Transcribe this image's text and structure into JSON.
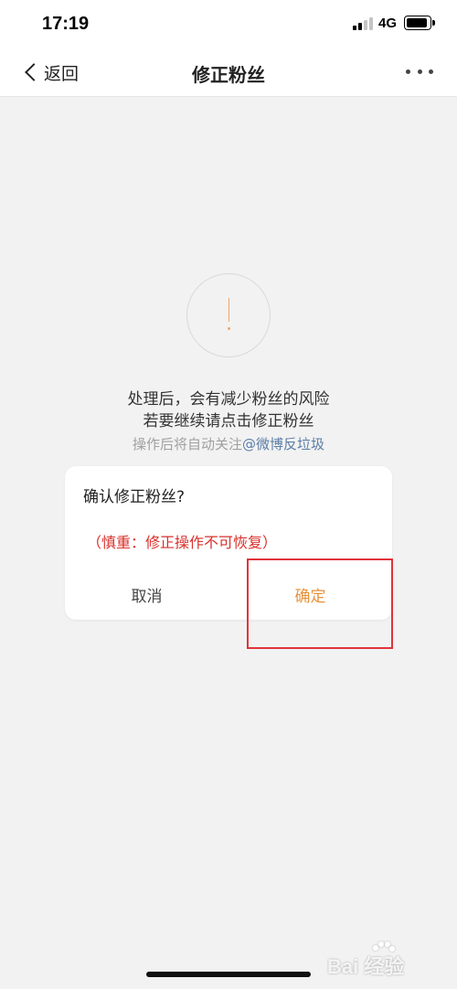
{
  "status_bar": {
    "time": "17:19",
    "network": "4G",
    "icons": [
      "signal-icon",
      "battery-icon"
    ]
  },
  "nav": {
    "back_label": "返回",
    "title": "修正粉丝",
    "more_icon": "more-icon"
  },
  "content": {
    "icon": "warning-icon",
    "message_line1": "处理后，会有减少粉丝的风险",
    "message_line2": "若要继续请点击修正粉丝",
    "note_prefix": "操作后将自动关注",
    "note_link": "@微博反垃圾"
  },
  "dialog": {
    "title": "确认修正粉丝?",
    "warning": "（慎重：修正操作不可恢复）",
    "cancel_label": "取消",
    "confirm_label": "确定"
  },
  "watermark": {
    "text": "Bai 经验"
  },
  "colors": {
    "accent": "#e8913a",
    "warning_text": "#d8312c",
    "link": "#5b7fa8",
    "annotation_box": "#e0333b",
    "background": "#f2f2f2"
  }
}
